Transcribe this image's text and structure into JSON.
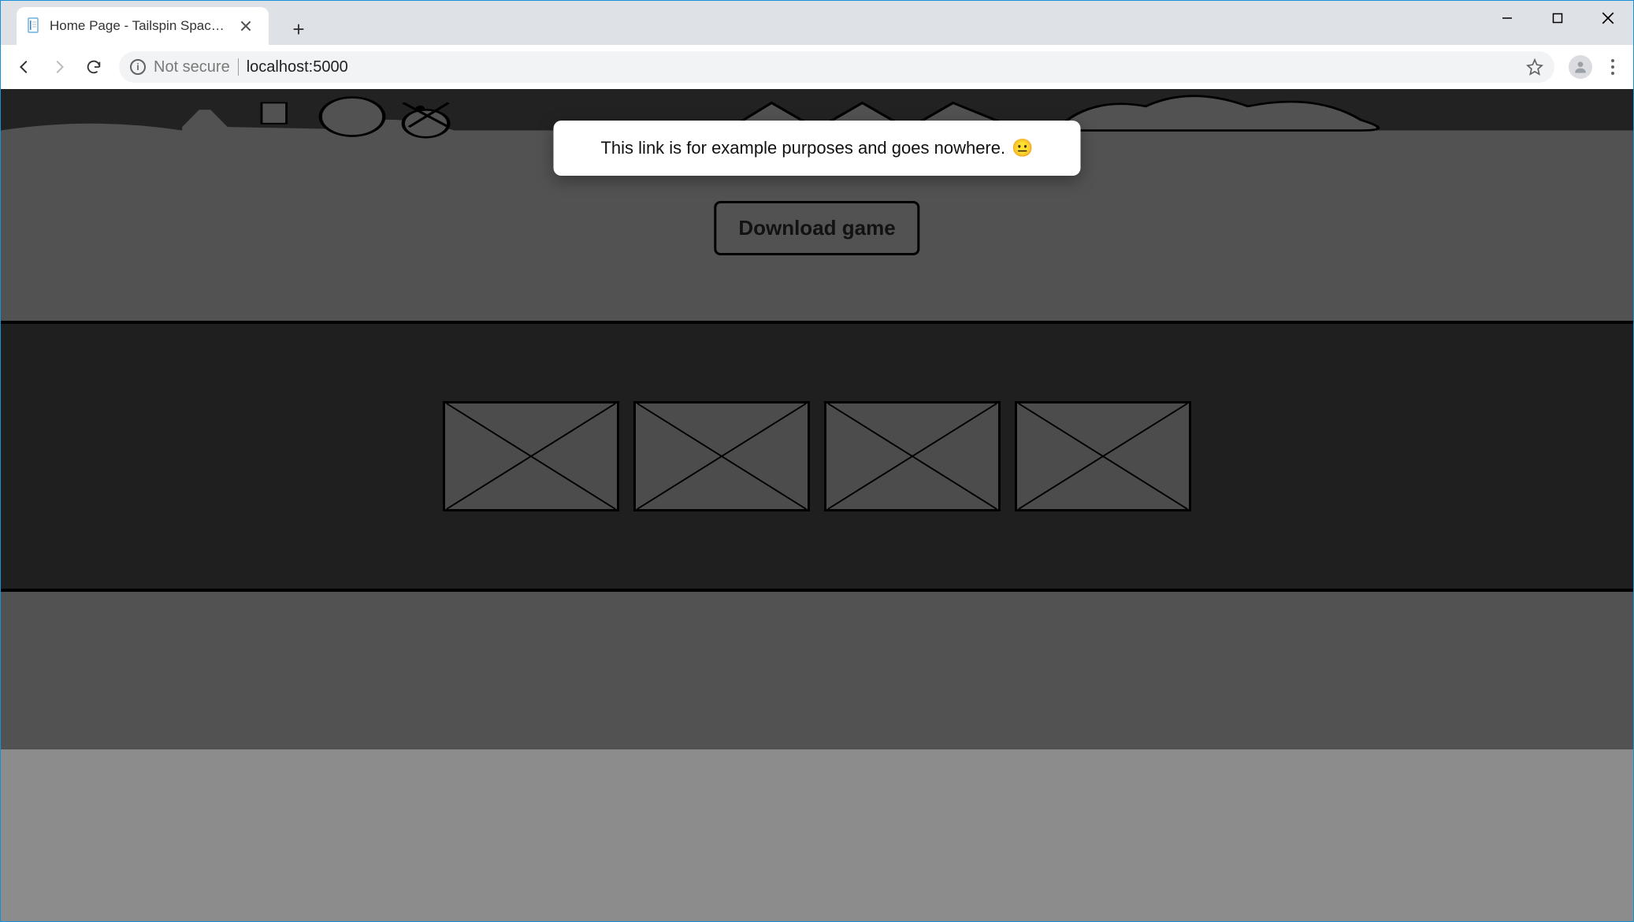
{
  "browser": {
    "tab_title": "Home Page - Tailspin SpaceGame",
    "security_label": "Not secure",
    "url": "localhost:5000"
  },
  "page": {
    "download_button": "Download game",
    "toast_message": "This link is for example purposes and goes nowhere.",
    "toast_emoji": "😐"
  }
}
